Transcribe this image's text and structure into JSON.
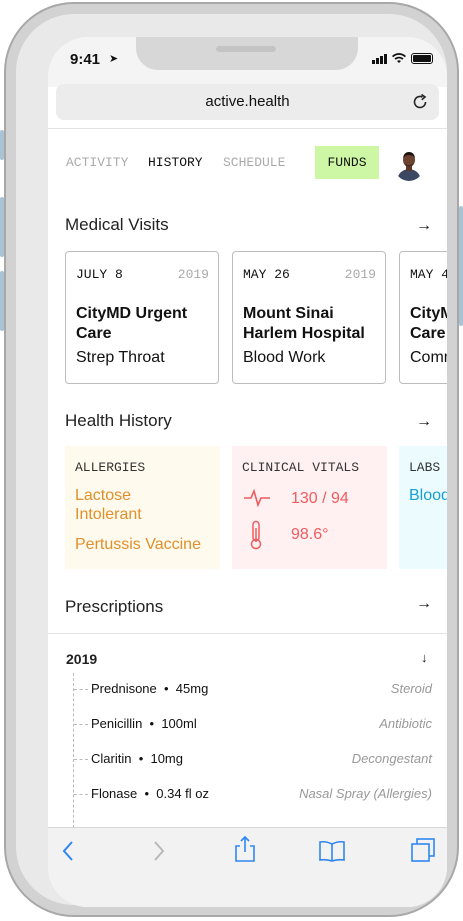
{
  "status_bar": {
    "time": "9:41"
  },
  "browser": {
    "url": "active.health"
  },
  "nav": {
    "tabs": [
      "ACTIVITY",
      "HISTORY",
      "SCHEDULE"
    ],
    "active_tab": "HISTORY",
    "funds_label": "FUNDS"
  },
  "medical_visits": {
    "title": "Medical Visits",
    "items": [
      {
        "date": "JULY 8",
        "year": "2019",
        "place": "CityMD Urgent Care",
        "reason": "Strep Throat"
      },
      {
        "date": "MAY 26",
        "year": "2019",
        "place": "Mount Sinai Harlem Hospital",
        "reason": "Blood Work"
      },
      {
        "date": "MAY 4",
        "year": "",
        "place": "CityMD Urgent Care",
        "reason": "Comm"
      }
    ]
  },
  "health_history": {
    "title": "Health History",
    "allergies": {
      "label": "ALLERGIES",
      "items": [
        "Lactose Intolerant",
        "Pertussis Vaccine"
      ]
    },
    "vitals": {
      "label": "CLINICAL VITALS",
      "blood_pressure": "130 / 94",
      "temperature": "98.6°"
    },
    "labs": {
      "label": "LABS",
      "text": "Blood sign other"
    }
  },
  "prescriptions": {
    "title": "Prescriptions",
    "year": "2019",
    "items": [
      {
        "name": "Prednisone",
        "dose": "45mg",
        "type": "Steroid"
      },
      {
        "name": "Penicillin",
        "dose": "100ml",
        "type": "Antibiotic"
      },
      {
        "name": "Claritin",
        "dose": "10mg",
        "type": "Decongestant"
      },
      {
        "name": "Flonase",
        "dose": "0.34 fl oz",
        "type": "Nasal Spray (Allergies)"
      }
    ]
  },
  "colors": {
    "funds_bg": "#cdf7a4",
    "allergy_text": "#e0902a",
    "vitals_text": "#ee5c60",
    "labs_text": "#17a0cf",
    "toolbar_icons": "#2f86f0"
  }
}
